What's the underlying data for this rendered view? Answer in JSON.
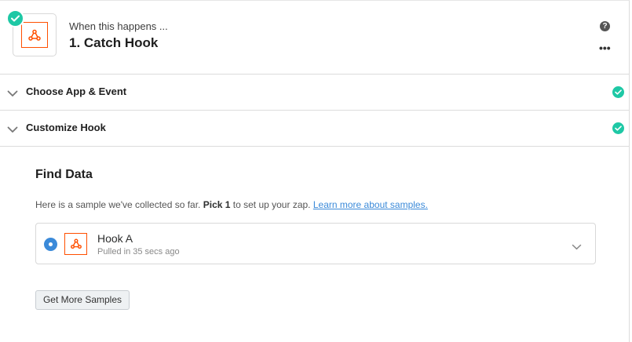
{
  "header": {
    "subtitle": "When this happens ...",
    "title": "1. Catch Hook",
    "help_icon_glyph": "?",
    "more_icon_glyph": "•••"
  },
  "sections": [
    {
      "label": "Choose App & Event",
      "status": "complete"
    },
    {
      "label": "Customize Hook",
      "status": "complete"
    }
  ],
  "find_data": {
    "title": "Find Data",
    "description_prefix": "Here is a sample we've collected so far. ",
    "description_bold": "Pick 1",
    "description_suffix": " to set up your zap. ",
    "learn_more_link": "Learn more about samples."
  },
  "sample": {
    "name": "Hook A",
    "meta": "Pulled in 35 secs ago",
    "selected": true
  },
  "get_more_button": "Get More Samples",
  "colors": {
    "brand_orange": "#ff4f00",
    "success_green": "#1ec8a5",
    "link_blue": "#3b8ad9"
  },
  "icons": {
    "app_logo": "webhook-icon",
    "status": "check-circle-icon",
    "help": "question-circle-icon",
    "more": "ellipsis-icon"
  }
}
